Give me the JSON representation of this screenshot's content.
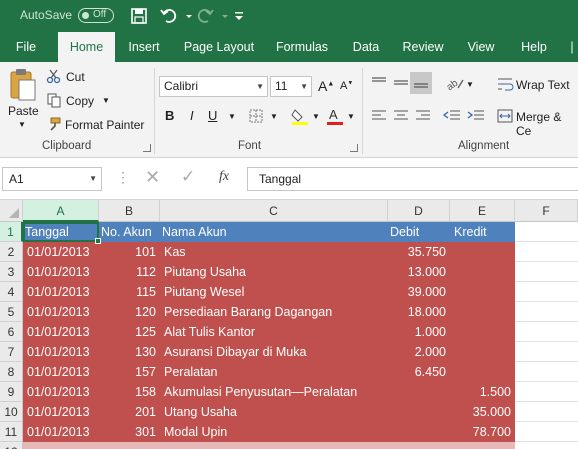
{
  "titlebar": {
    "autosave_label": "AutoSave",
    "autosave_state": "Off",
    "icons": [
      "save-icon",
      "undo-icon",
      "redo-icon",
      "customize-qat-icon"
    ]
  },
  "tabs": [
    "File",
    "Home",
    "Insert",
    "Page Layout",
    "Formulas",
    "Data",
    "Review",
    "View",
    "Help"
  ],
  "active_tab": "Home",
  "ribbon": {
    "clipboard": {
      "paste": "Paste",
      "cut": "Cut",
      "copy": "Copy",
      "format_painter": "Format Painter",
      "label": "Clipboard"
    },
    "font": {
      "font_name": "Calibri",
      "font_size": "11",
      "bold": "B",
      "italic": "I",
      "underline": "U",
      "label": "Font"
    },
    "alignment": {
      "wrap_text": "Wrap Text",
      "merge": "Merge & Ce",
      "label": "Alignment"
    }
  },
  "formula_bar": {
    "name_box": "A1",
    "fx": "fx",
    "content": "Tanggal"
  },
  "columns": [
    "A",
    "B",
    "C",
    "D",
    "E",
    "F"
  ],
  "rows": [
    "1",
    "2",
    "3",
    "4",
    "5",
    "6",
    "7",
    "8",
    "9",
    "10",
    "11",
    "12"
  ],
  "sheet": {
    "header": [
      "Tanggal",
      "No. Akun",
      "Nama Akun",
      "Debit",
      "Kredit"
    ],
    "data": [
      [
        "01/01/2013",
        "101",
        "Kas",
        "35.750",
        ""
      ],
      [
        "01/01/2013",
        "112",
        "Piutang Usaha",
        "13.000",
        ""
      ],
      [
        "01/01/2013",
        "115",
        "Piutang Wesel",
        "39.000",
        ""
      ],
      [
        "01/01/2013",
        "120",
        "Persediaan Barang Dagangan",
        "18.000",
        ""
      ],
      [
        "01/01/2013",
        "125",
        "Alat Tulis Kantor",
        "1.000",
        ""
      ],
      [
        "01/01/2013",
        "130",
        "Asuransi Dibayar di Muka",
        "2.000",
        ""
      ],
      [
        "01/01/2013",
        "157",
        "Peralatan",
        "6.450",
        ""
      ],
      [
        "01/01/2013",
        "158",
        "Akumulasi Penyusutan—Peralatan",
        "",
        "1.500"
      ],
      [
        "01/01/2013",
        "201",
        "Utang Usaha",
        "",
        "35.000"
      ],
      [
        "01/01/2013",
        "301",
        "Modal Upin",
        "",
        "78.700"
      ]
    ]
  },
  "colors": {
    "excel_green": "#217346",
    "header_fill": "#4f81bd",
    "data_fill": "#c0504d"
  }
}
